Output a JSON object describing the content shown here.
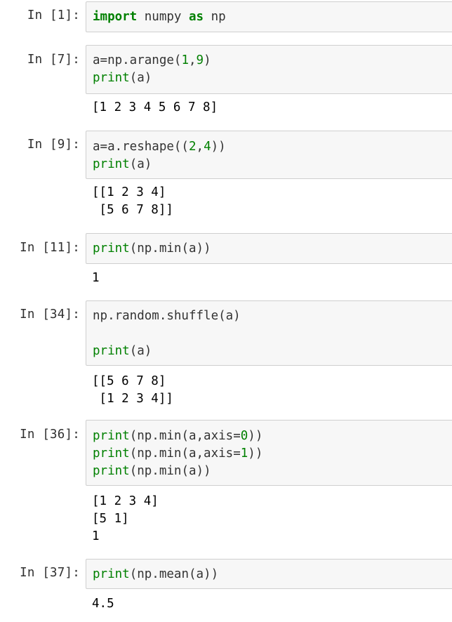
{
  "cells": [
    {
      "prompt": "In [1]:",
      "code": [
        [
          {
            "t": "import",
            "c": "kw"
          },
          {
            "t": " numpy ",
            "c": "nm"
          },
          {
            "t": "as",
            "c": "kw"
          },
          {
            "t": " np",
            "c": "nm"
          }
        ]
      ],
      "output": []
    },
    {
      "prompt": "In [7]:",
      "code": [
        [
          {
            "t": "a=np.arange(",
            "c": "nm"
          },
          {
            "t": "1",
            "c": "num"
          },
          {
            "t": ",",
            "c": "nm"
          },
          {
            "t": "9",
            "c": "num"
          },
          {
            "t": ")",
            "c": "nm"
          }
        ],
        [
          {
            "t": "print",
            "c": "bi"
          },
          {
            "t": "(a)",
            "c": "nm"
          }
        ]
      ],
      "output": [
        "[1 2 3 4 5 6 7 8]"
      ]
    },
    {
      "prompt": "In [9]:",
      "code": [
        [
          {
            "t": "a=a.reshape((",
            "c": "nm"
          },
          {
            "t": "2",
            "c": "num"
          },
          {
            "t": ",",
            "c": "nm"
          },
          {
            "t": "4",
            "c": "num"
          },
          {
            "t": "))",
            "c": "nm"
          }
        ],
        [
          {
            "t": "print",
            "c": "bi"
          },
          {
            "t": "(a)",
            "c": "nm"
          }
        ]
      ],
      "output": [
        "[[1 2 3 4]",
        " [5 6 7 8]]"
      ]
    },
    {
      "prompt": "In [11]:",
      "code": [
        [
          {
            "t": "print",
            "c": "bi"
          },
          {
            "t": "(np.min(a))",
            "c": "nm"
          }
        ]
      ],
      "output": [
        "1"
      ]
    },
    {
      "prompt": "In [34]:",
      "code": [
        [
          {
            "t": "np.random.shuffle(a)",
            "c": "nm"
          }
        ],
        [],
        [
          {
            "t": "print",
            "c": "bi"
          },
          {
            "t": "(a)",
            "c": "nm"
          }
        ]
      ],
      "output": [
        "[[5 6 7 8]",
        " [1 2 3 4]]"
      ]
    },
    {
      "prompt": "In [36]:",
      "code": [
        [
          {
            "t": "print",
            "c": "bi"
          },
          {
            "t": "(np.min(a,axis=",
            "c": "nm"
          },
          {
            "t": "0",
            "c": "num"
          },
          {
            "t": "))",
            "c": "nm"
          }
        ],
        [
          {
            "t": "print",
            "c": "bi"
          },
          {
            "t": "(np.min(a,axis=",
            "c": "nm"
          },
          {
            "t": "1",
            "c": "num"
          },
          {
            "t": "))",
            "c": "nm"
          }
        ],
        [
          {
            "t": "print",
            "c": "bi"
          },
          {
            "t": "(np.min(a))",
            "c": "nm"
          }
        ]
      ],
      "output": [
        "[1 2 3 4]",
        "[5 1]",
        "1"
      ]
    },
    {
      "prompt": "In [37]:",
      "code": [
        [
          {
            "t": "print",
            "c": "bi"
          },
          {
            "t": "(np.mean(a))",
            "c": "nm"
          }
        ]
      ],
      "output": [
        "4.5"
      ]
    }
  ]
}
